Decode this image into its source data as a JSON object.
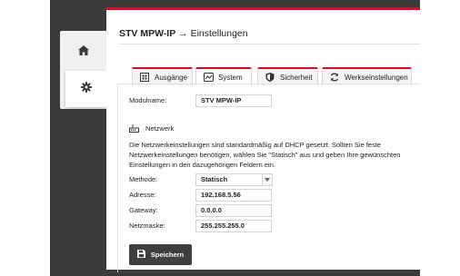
{
  "nav": {
    "items": [
      {
        "name": "home",
        "icon": "home-icon"
      },
      {
        "name": "settings",
        "icon": "gear-icon",
        "active": true
      }
    ]
  },
  "header": {
    "device_name": "STV MPW-IP",
    "arrow": "→",
    "page_title": "Einstellungen"
  },
  "tabs": [
    {
      "label": "Ausgänge",
      "icon": "outputs-icon"
    },
    {
      "label": "System",
      "icon": "system-icon",
      "active": true
    },
    {
      "label": "Sicherheit",
      "icon": "shield-icon"
    },
    {
      "label": "Werkseinstellungen",
      "icon": "reset-icon"
    }
  ],
  "form": {
    "module_name_label": "Modulname:",
    "module_name_value": "STV MPW-IP",
    "network_heading": "Netzwerk",
    "network_description": "Die Netzwerkeinstellungen sind standardmäßig auf DHCP gesetzt. Sollten Sie feste Netzwerkeinstellungen benötigen, wählen Sie \"Statisch\" aus und geben Ihre gewünschten Einstellungen in den dazugehörigen Feldern ein.",
    "method_label": "Methode:",
    "method_value": "Statisch",
    "address_label": "Adresse:",
    "address_value": "192.168.5.56",
    "gateway_label": "Gateway:",
    "gateway_value": "0.0.0.0",
    "netmask_label": "Netzmaske:",
    "netmask_value": "255.255.255.0",
    "save_label": "Speichern"
  },
  "colors": {
    "accent": "#c8102e",
    "frame": "#3b3b3b",
    "button": "#3f3f3f"
  }
}
